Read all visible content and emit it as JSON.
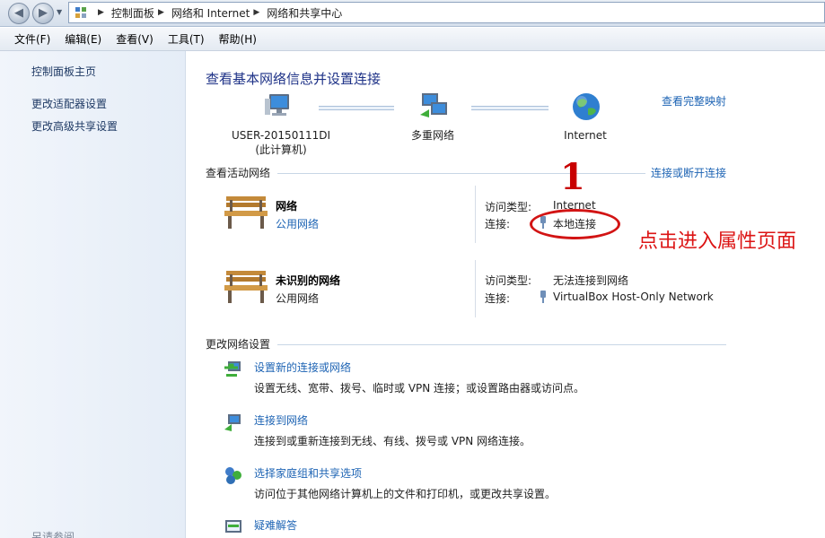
{
  "address_bar": {
    "breadcrumbs": [
      "控制面板",
      "网络和 Internet",
      "网络和共享中心"
    ]
  },
  "menu": [
    "文件(F)",
    "编辑(E)",
    "查看(V)",
    "工具(T)",
    "帮助(H)"
  ],
  "sidebar": {
    "home": "控制面板主页",
    "adapter_settings": "更改适配器设置",
    "sharing_settings": "更改高级共享设置",
    "see_also": "另请参阅"
  },
  "main": {
    "title": "查看基本网络信息并设置连接",
    "full_map_link": "查看完整映射",
    "map": {
      "computer_name": "USER-20150111DI",
      "computer_sub": "(此计算机)",
      "multi_network": "多重网络",
      "internet": "Internet"
    },
    "active_networks": {
      "heading": "查看活动网络",
      "connect_link": "连接或断开连接",
      "networks": [
        {
          "name": "网络",
          "type": "公用网络",
          "access_label": "访问类型:",
          "access_value": "Internet",
          "conn_label": "连接:",
          "conn_value": "本地连接"
        },
        {
          "name": "未识别的网络",
          "type": "公用网络",
          "access_label": "访问类型:",
          "access_value": "无法连接到网络",
          "conn_label": "连接:",
          "conn_value": "VirtualBox Host-Only Network"
        }
      ]
    },
    "change_settings": {
      "heading": "更改网络设置",
      "tasks": [
        {
          "link": "设置新的连接或网络",
          "desc": "设置无线、宽带、拨号、临时或 VPN 连接；或设置路由器或访问点。"
        },
        {
          "link": "连接到网络",
          "desc": "连接到或重新连接到无线、有线、拨号或 VPN 网络连接。"
        },
        {
          "link": "选择家庭组和共享选项",
          "desc": "访问位于其他网络计算机上的文件和打印机，或更改共享设置。"
        },
        {
          "link": "疑难解答",
          "desc": ""
        }
      ]
    }
  },
  "annotation": {
    "number": "1",
    "text": "点击进入属性页面"
  },
  "colors": {
    "link": "#1e64b4",
    "title": "#1e3287",
    "annotation": "#d21414"
  }
}
